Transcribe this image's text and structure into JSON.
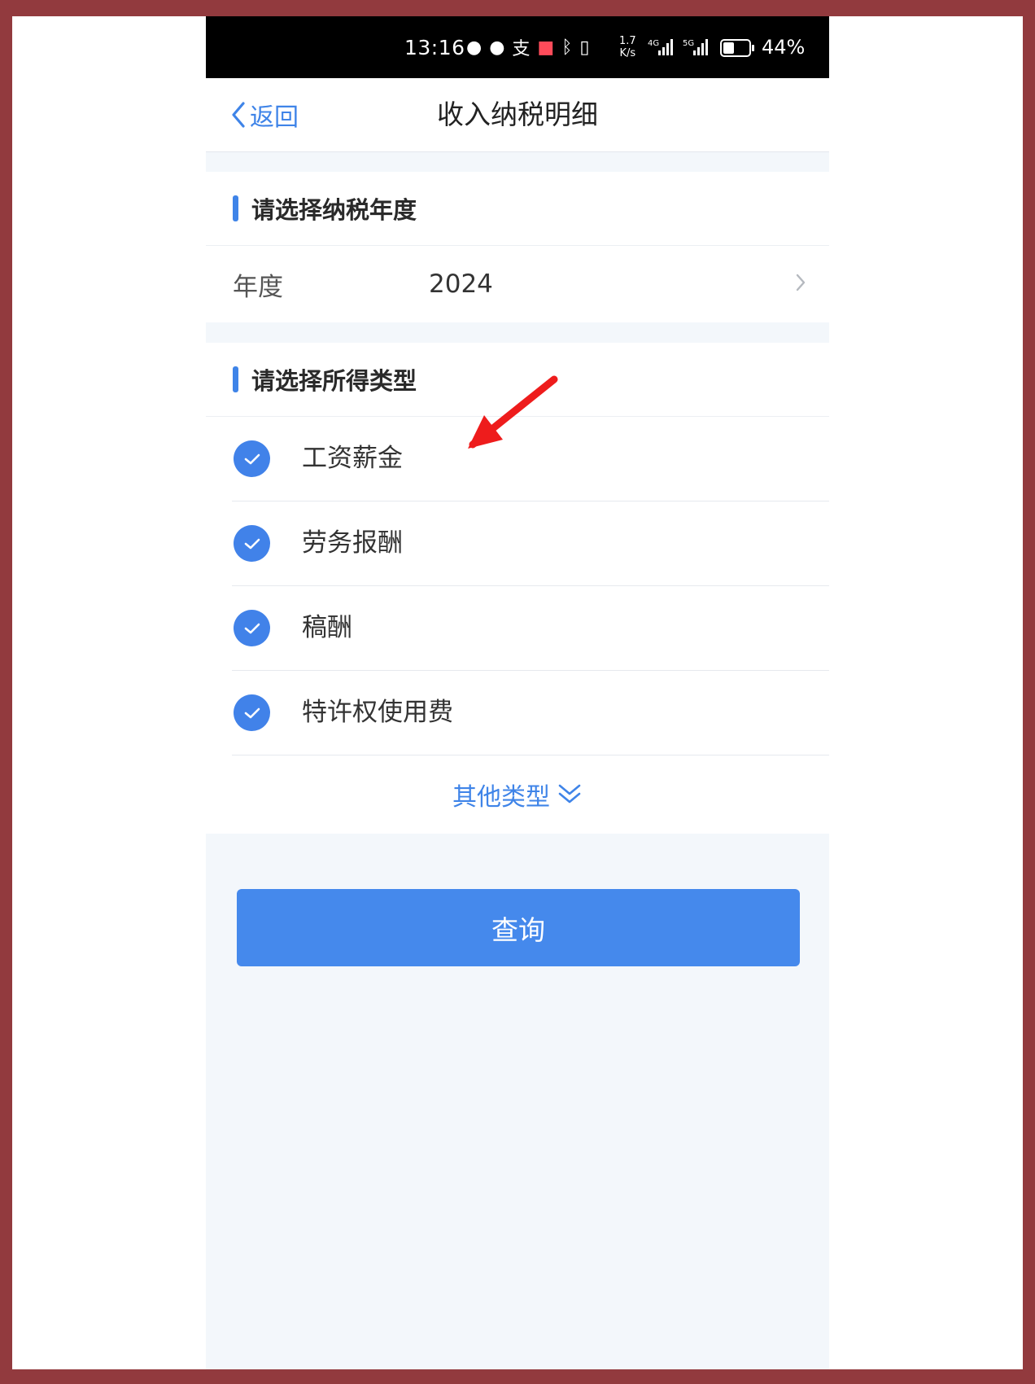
{
  "status_bar": {
    "time": "13:16",
    "net_speed_value": "1.7",
    "net_speed_unit": "K/s",
    "network_1": "4G",
    "network_2": "5G",
    "battery_percent": "44%",
    "battery_level": 0.44
  },
  "nav": {
    "back_label": "返回",
    "title": "收入纳税明细"
  },
  "year_section": {
    "header": "请选择纳税年度",
    "field_label": "年度",
    "field_value": "2024"
  },
  "income_section": {
    "header": "请选择所得类型",
    "options": [
      {
        "label": "工资薪金",
        "checked": true
      },
      {
        "label": "劳务报酬",
        "checked": true
      },
      {
        "label": "稿酬",
        "checked": true
      },
      {
        "label": "特许权使用费",
        "checked": true
      }
    ],
    "more_label": "其他类型"
  },
  "query_button": "查询",
  "colors": {
    "accent": "#4182e9",
    "annotation_arrow": "#ee1c1c",
    "frame": "#923a3e"
  }
}
